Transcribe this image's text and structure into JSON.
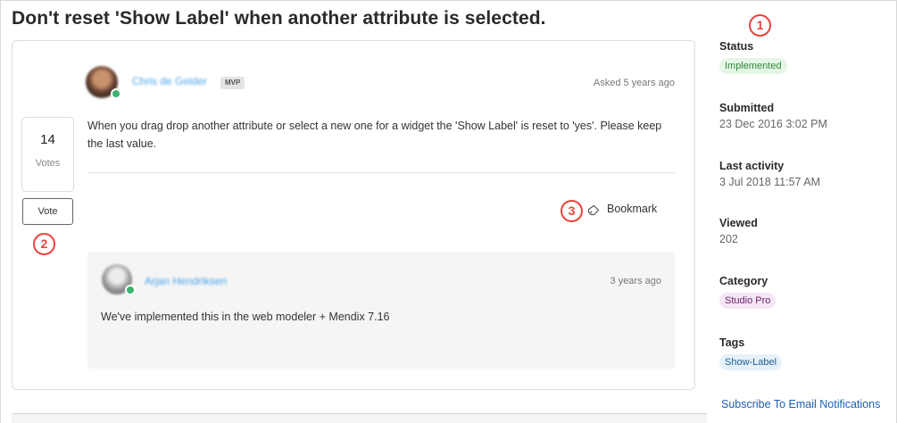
{
  "idea": {
    "title": "Don't reset 'Show Label' when another attribute is selected."
  },
  "post": {
    "author": "Chris de Gelder",
    "badge": "MVP",
    "asked": "Asked 5 years ago",
    "body": "When you drag drop another attribute or select a new one for a widget the 'Show Label' is reset to 'yes'. Please keep the last value.",
    "bookmark_label": "Bookmark"
  },
  "vote": {
    "count": "14",
    "count_label": "Votes",
    "button_label": "Vote"
  },
  "reply": {
    "author": "Arjan Hendriksen",
    "time": "3 years ago",
    "text": "We've implemented this in the web modeler + Mendix 7.16"
  },
  "sidebar": {
    "status_label": "Status",
    "status_value": "Implemented",
    "submitted_label": "Submitted",
    "submitted_value": "23 Dec 2016 3:02 PM",
    "last_activity_label": "Last activity",
    "last_activity_value": "3 Jul 2018 11:57 AM",
    "viewed_label": "Viewed",
    "viewed_value": "202",
    "category_label": "Category",
    "category_value": "Studio Pro",
    "tags_label": "Tags",
    "tag_value": "Show-Label",
    "subscribe_label": "Subscribe To Email Notifications"
  },
  "markers": [
    "1",
    "2",
    "3"
  ],
  "icons": {
    "bookmark": "bookmark-tag-icon"
  },
  "colors": {
    "marker": "#e8453c",
    "link": "#1a5fb4",
    "status_bg": "#e6f6e6",
    "status_text": "#2e8b3a",
    "category_bg": "#f5e6f5",
    "tag_bg": "#e6f1fa"
  }
}
